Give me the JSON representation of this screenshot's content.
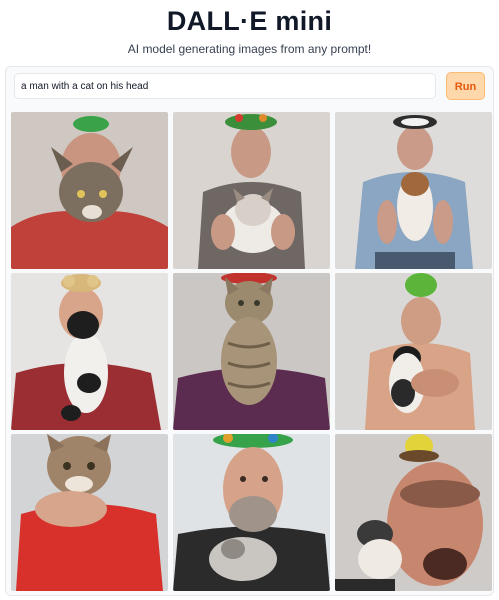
{
  "app": {
    "title": "DALL·E mini",
    "subtitle": "AI model generating images from any prompt!"
  },
  "prompt": {
    "value": "a man with a cat on his head"
  },
  "run_button": {
    "label": "Run"
  },
  "colors": {
    "accent": "#ea580c",
    "run_bg": "#fed7aa"
  },
  "results": [
    {
      "subject": "man-with-cat-face-red-shirt"
    },
    {
      "subject": "man-holding-kitten-grey-shirt"
    },
    {
      "subject": "man-holding-cat-blue-shirt"
    },
    {
      "subject": "man-with-black-white-cat-maroon-shirt"
    },
    {
      "subject": "tabby-cat-on-purple-shirt"
    },
    {
      "subject": "shirtless-man-holding-cat"
    },
    {
      "subject": "cat-head-red-sweater"
    },
    {
      "subject": "bearded-man-with-kitten"
    },
    {
      "subject": "man-face-with-cat-closeup"
    }
  ]
}
